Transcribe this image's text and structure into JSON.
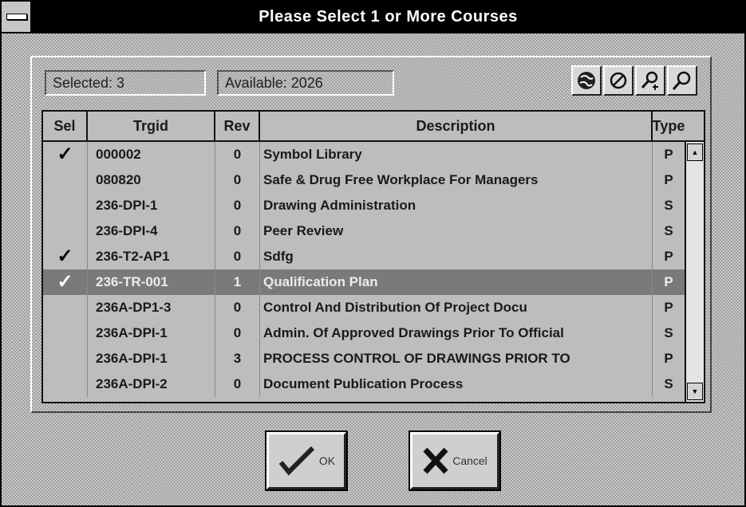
{
  "window": {
    "title": "Please Select 1 or More Courses"
  },
  "info": {
    "selected": "Selected: 3",
    "available": "Available: 2026"
  },
  "toolbar": [
    {
      "name": "select-all-button",
      "icon": "globe-icon"
    },
    {
      "name": "clear-selection-button",
      "icon": "no-symbol-icon"
    },
    {
      "name": "search-button",
      "icon": "magnifier-plus-icon"
    },
    {
      "name": "search-next-button",
      "icon": "magnifier-icon"
    }
  ],
  "grid": {
    "columns": [
      "Sel",
      "Trgid",
      "Rev",
      "Description",
      "Type"
    ],
    "rows": [
      {
        "sel": true,
        "trgid": "000002",
        "rev": "0",
        "description": "Symbol Library",
        "type": "P"
      },
      {
        "sel": false,
        "trgid": "080820",
        "rev": "0",
        "description": "Safe & Drug Free Workplace For Managers",
        "type": "P"
      },
      {
        "sel": false,
        "trgid": "236-DPI-1",
        "rev": "0",
        "description": "Drawing Administration",
        "type": "S"
      },
      {
        "sel": false,
        "trgid": "236-DPI-4",
        "rev": "0",
        "description": "Peer Review",
        "type": "S"
      },
      {
        "sel": true,
        "trgid": "236-T2-AP1",
        "rev": "0",
        "description": "Sdfg",
        "type": "P"
      },
      {
        "sel": true,
        "trgid": "236-TR-001",
        "rev": "1",
        "description": "Qualification Plan",
        "type": "P",
        "highlight": true
      },
      {
        "sel": false,
        "trgid": "236A-DP1-3",
        "rev": "0",
        "description": "Control And Distribution Of Project Docu",
        "type": "P"
      },
      {
        "sel": false,
        "trgid": "236A-DPI-1",
        "rev": "0",
        "description": "Admin. Of Approved Drawings Prior To Official",
        "type": "S"
      },
      {
        "sel": false,
        "trgid": "236A-DPI-1",
        "rev": "3",
        "description": "PROCESS CONTROL OF DRAWINGS PRIOR TO",
        "type": "P"
      },
      {
        "sel": false,
        "trgid": "236A-DPI-2",
        "rev": "0",
        "description": "Document Publication Process",
        "type": "S"
      }
    ]
  },
  "buttons": {
    "ok": "OK",
    "cancel": "Cancel"
  },
  "check_glyph": "✓",
  "colors": {
    "titlebar": "#000000",
    "face": "#c6c6c6",
    "highlight_row": "#7a7a7a"
  }
}
